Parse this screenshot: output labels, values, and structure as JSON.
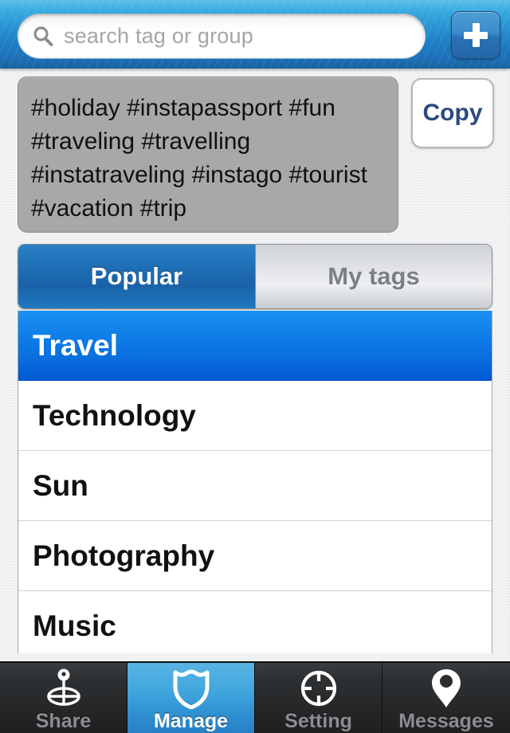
{
  "header": {
    "search": {
      "icon": "search-icon",
      "placeholder": "search tag or group",
      "value": ""
    },
    "add_button": {
      "icon": "plus-icon",
      "label": "+"
    },
    "colors": {
      "bar_top": "#5cc0ea",
      "bar_bottom": "#17619f"
    }
  },
  "tag_preview": {
    "text": "#holiday #instapassport #fun #traveling #travelling #instatraveling #instago #tourist #vacation #trip",
    "tags": [
      "#holiday",
      "#instapassport",
      "#fun",
      "#traveling",
      "#travelling",
      "#instatraveling",
      "#instago",
      "#tourist",
      "#vacation",
      "#trip"
    ],
    "copy_label": "Copy",
    "background_color": "#a8a8a8",
    "copy_text_color": "#2b4a80"
  },
  "segmented_control": {
    "selected": "Popular",
    "options": [
      {
        "label": "Popular",
        "selected": true
      },
      {
        "label": "My tags",
        "selected": false
      }
    ]
  },
  "group_list": {
    "selected": "Travel",
    "items": [
      {
        "label": "Travel",
        "selected": true
      },
      {
        "label": "Technology",
        "selected": false
      },
      {
        "label": "Sun",
        "selected": false
      },
      {
        "label": "Photography",
        "selected": false
      },
      {
        "label": "Music",
        "selected": false
      }
    ]
  },
  "tabbar": {
    "selected": "Manage",
    "items": [
      {
        "label": "Share",
        "icon": "share-pin-icon",
        "selected": false
      },
      {
        "label": "Manage",
        "icon": "shield-icon",
        "selected": true
      },
      {
        "label": "Setting",
        "icon": "crosshair-icon",
        "selected": false
      },
      {
        "label": "Messages",
        "icon": "map-pin-icon",
        "selected": false
      }
    ],
    "accent_color": "#2f8fd0"
  }
}
